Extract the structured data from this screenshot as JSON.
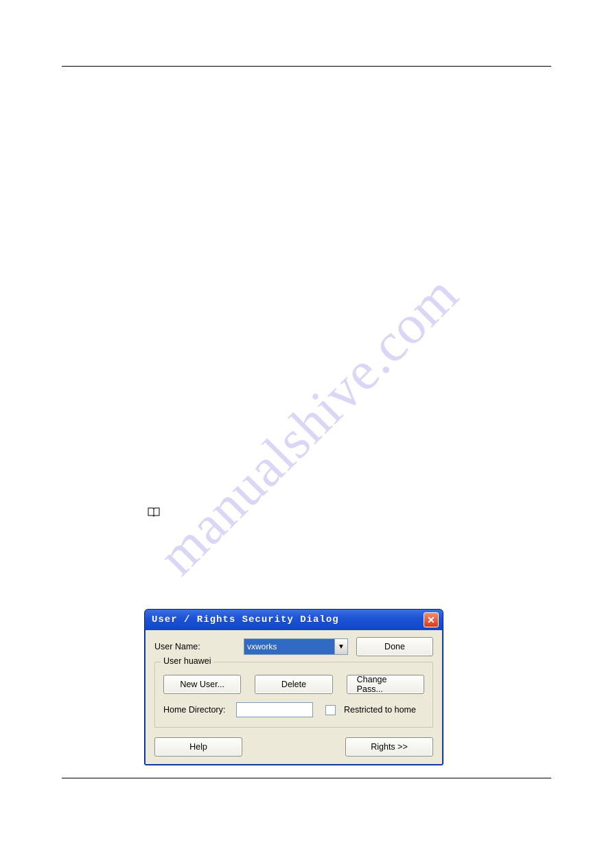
{
  "watermark_text": "manualshive.com",
  "dialog": {
    "title": "User / Rights Security Dialog",
    "close_glyph": "✕",
    "username_label": "User Name:",
    "username_selected": "vxworks",
    "done_label": "Done",
    "group_legend": "User huawei",
    "new_user_label": "New User...",
    "delete_label": "Delete",
    "change_pass_label": "Change Pass...",
    "home_dir_label": "Home Directory:",
    "home_dir_value": "",
    "restricted_label": "Restricted to home",
    "help_label": "Help",
    "rights_label": "Rights >>"
  }
}
